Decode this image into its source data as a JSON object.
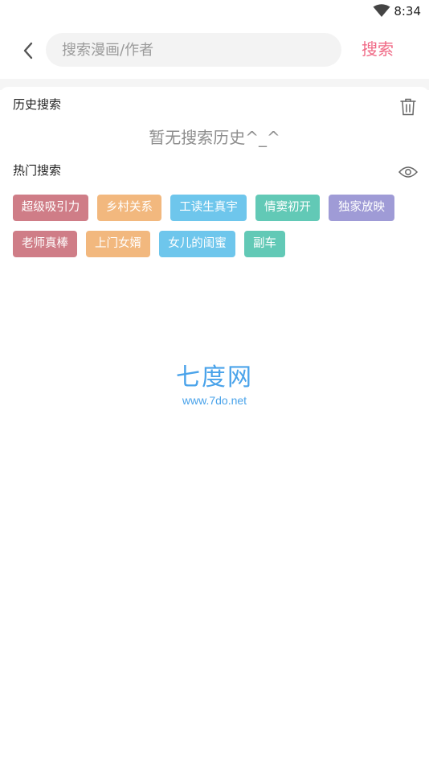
{
  "status_bar": {
    "time": "8:34",
    "wifi_icon": "wifi-icon"
  },
  "top_bar": {
    "back_icon": "chevron-left-icon",
    "search_placeholder": "搜索漫画/作者",
    "search_value": "",
    "search_button": "搜索"
  },
  "history": {
    "title": "历史搜索",
    "clear_icon": "trash-icon",
    "empty_text": "暂无搜索历史^_^"
  },
  "hot": {
    "title": "热门搜索",
    "toggle_icon": "eye-icon",
    "tags": [
      {
        "label": "超级吸引力",
        "color": "#cf7d87"
      },
      {
        "label": "乡村关系",
        "color": "#f2b87e"
      },
      {
        "label": "工读生真宇",
        "color": "#6ec6ec"
      },
      {
        "label": "情窦初开",
        "color": "#62c9b6"
      },
      {
        "label": "独家放映",
        "color": "#9f9bd6"
      },
      {
        "label": "老师真棒",
        "color": "#cf7d87"
      },
      {
        "label": "上门女婿",
        "color": "#f2b87e"
      },
      {
        "label": "女儿的闺蜜",
        "color": "#6ec6ec"
      },
      {
        "label": "副车",
        "color": "#62c9b6"
      }
    ]
  },
  "watermark": {
    "main": "七度网",
    "sub": "www.7do.net"
  },
  "colors": {
    "accent": "#f06a86",
    "watermark": "#4aa3ea"
  }
}
